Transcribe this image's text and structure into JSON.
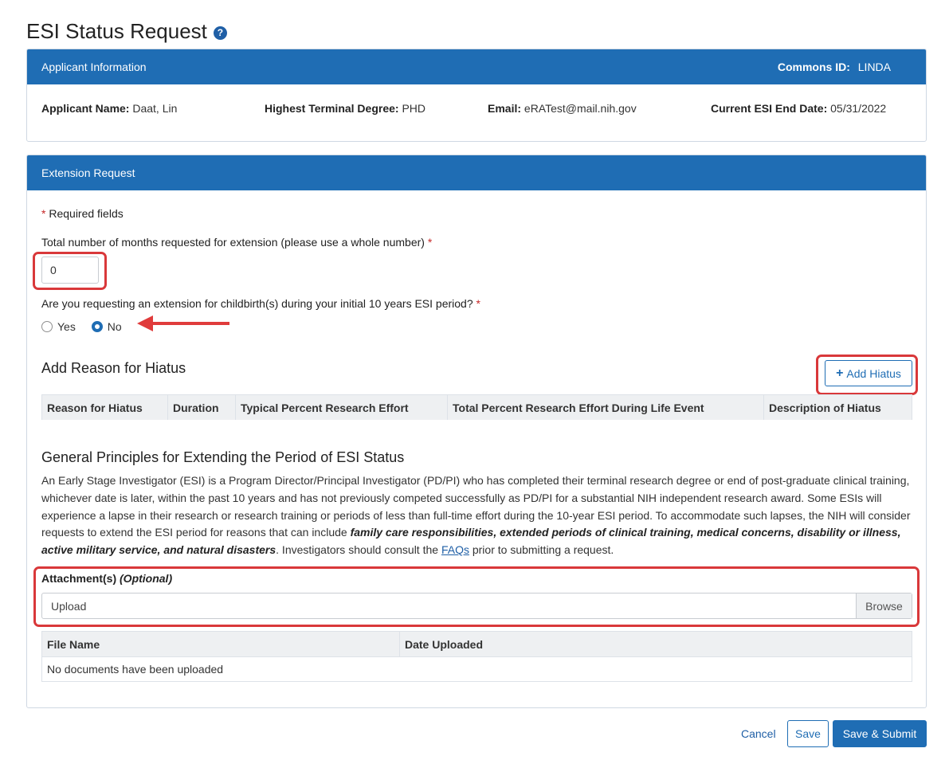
{
  "page": {
    "title": "ESI Status Request",
    "help_icon": "question-circle-icon"
  },
  "applicant": {
    "header": "Applicant Information",
    "commons_id_label": "Commons ID:",
    "commons_id_value": "LINDA",
    "name_label": "Applicant Name:",
    "name_value": "Daat, Lin",
    "degree_label": "Highest Terminal Degree:",
    "degree_value": "PHD",
    "email_label": "Email:",
    "email_value": "eRATest@mail.nih.gov",
    "esi_end_label": "Current ESI End Date:",
    "esi_end_value": "05/31/2022"
  },
  "extension": {
    "header": "Extension Request",
    "required_note": "Required fields",
    "months_label": "Total number of months requested for extension (please use a whole number)",
    "months_value": "0",
    "childbirth_label": "Are you requesting an extension for childbirth(s) during your initial 10 years ESI period?",
    "yes_label": "Yes",
    "no_label": "No",
    "selected": "No"
  },
  "hiatus": {
    "title": "Add Reason for Hiatus",
    "add_button": "Add Hiatus",
    "columns": [
      "Reason for Hiatus",
      "Duration",
      "Typical Percent Research Effort",
      "Total Percent Research Effort During Life Event",
      "Description of Hiatus"
    ]
  },
  "principles": {
    "title": "General Principles for Extending the Period of ESI Status",
    "text_1": "An Early Stage Investigator (ESI) is a Program Director/Principal Investigator (PD/PI) who has completed their terminal research degree or end of post-graduate clinical training, whichever date is later, within the past 10 years and has not previously competed successfully as PD/PI for a substantial NIH independent research award. Some ESIs will experience a lapse in their research or research training or periods of less than full-time effort during the 10-year ESI period. To accommodate such lapses, the NIH will consider requests to extend the ESI period for reasons that can include ",
    "text_bold": "family care responsibilities, extended periods of clinical training, medical concerns, disability or illness, active military service, and natural disasters",
    "text_2": ". Investigators should consult the ",
    "faq_link": "FAQs",
    "text_3": " prior to submitting a request."
  },
  "attachments": {
    "label": "Attachment(s)",
    "optional": "(Optional)",
    "placeholder": "Upload",
    "browse": "Browse",
    "columns": [
      "File Name",
      "Date Uploaded"
    ],
    "empty_message": "No documents have been uploaded"
  },
  "footer": {
    "cancel": "Cancel",
    "save": "Save",
    "save_submit": "Save & Submit"
  }
}
